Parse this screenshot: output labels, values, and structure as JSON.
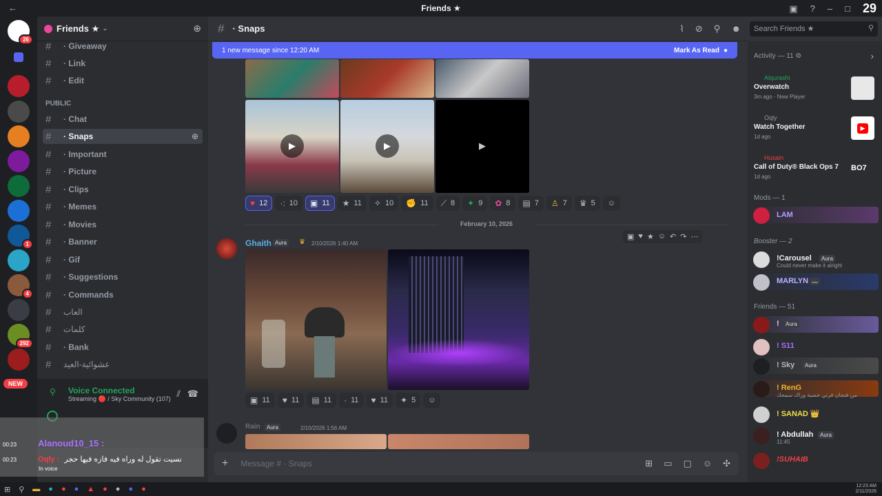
{
  "window": {
    "title": "Friends ★",
    "corner_number": "29"
  },
  "server_rail": {
    "badges": {
      "home": "26",
      "s7": "1",
      "s10": "4",
      "s12": "292"
    },
    "new_label": "NEW"
  },
  "guild": {
    "name": "Friends ★"
  },
  "channels_top": [
    {
      "label": "· Giveaway"
    },
    {
      "label": "· Link"
    },
    {
      "label": "· Edit"
    }
  ],
  "category_public": "PUBLIC",
  "channels": [
    {
      "label": "· Chat"
    },
    {
      "label": "· Snaps"
    },
    {
      "label": "· Important"
    },
    {
      "label": "· Picture"
    },
    {
      "label": "· Clips"
    },
    {
      "label": "· Memes"
    },
    {
      "label": "· Movies"
    },
    {
      "label": "· Banner"
    },
    {
      "label": "· Gif"
    },
    {
      "label": "· Suggestions"
    },
    {
      "label": "· Commands"
    },
    {
      "label": "العاب"
    },
    {
      "label": "كلمات"
    },
    {
      "label": "· Bank"
    },
    {
      "label": "عشوائية-العيد"
    }
  ],
  "voice": {
    "title": "Voice Connected",
    "subtitle": "Streaming 🔴 / Sky Community (107)"
  },
  "overlay": {
    "line1_time": "00:23",
    "line1_user": "Alanoud10_15 :",
    "line2_time": "00:23",
    "line2_user": "Oqly :",
    "line2_text": "نسيت تقول له وراه فيه فازه فيها حجر",
    "line3": "In voice"
  },
  "chat_header": {
    "channel": "· Snaps"
  },
  "search": {
    "placeholder": "Search Friends ★"
  },
  "new_messages": {
    "text": "1 new message since 12:20 AM",
    "action": "Mark As Read"
  },
  "reactions_1": [
    {
      "emoji": "♥",
      "count": "12",
      "me": true
    },
    {
      "emoji": "·:",
      "count": "10",
      "me": false
    },
    {
      "emoji": "▣",
      "count": "11",
      "me": true
    },
    {
      "emoji": "★",
      "count": "11",
      "me": false
    },
    {
      "emoji": "✧",
      "count": "10",
      "me": false
    },
    {
      "emoji": "✊",
      "count": "11",
      "me": false
    },
    {
      "emoji": "⟋",
      "count": "8",
      "me": false
    },
    {
      "emoji": "✦",
      "count": "9",
      "me": false
    },
    {
      "emoji": "✿",
      "count": "8",
      "me": false
    },
    {
      "emoji": "▤",
      "count": "7",
      "me": false
    },
    {
      "emoji": "♙",
      "count": "7",
      "me": false
    },
    {
      "emoji": "♛",
      "count": "5",
      "me": false
    }
  ],
  "date_divider": "February 10, 2026",
  "message": {
    "author": "Ghaith",
    "tag": "Aura",
    "timestamp": "2/10/2026 1:40 AM"
  },
  "reactions_2": [
    {
      "emoji": "▣",
      "count": "11"
    },
    {
      "emoji": "♥",
      "count": "11"
    },
    {
      "emoji": "▤",
      "count": "11"
    },
    {
      "emoji": "·",
      "count": "11"
    },
    {
      "emoji": "♥",
      "count": "11"
    },
    {
      "emoji": "✦",
      "count": "5"
    }
  ],
  "next_message": {
    "author": "Rain",
    "tag": "Aura",
    "timestamp": "2/10/2026 1:56 AM"
  },
  "composer": {
    "placeholder": "Message # · Snaps"
  },
  "activity": {
    "header": "Activity — 11",
    "items": [
      {
        "user": "Alqurashi",
        "game": "Overwatch",
        "meta": "3m ago · New Player"
      },
      {
        "user": "Oqly",
        "game": "Watch Together",
        "meta": "1d ago"
      },
      {
        "user": "Husain",
        "game": "Call of Duty® Black Ops 7",
        "meta": "1d ago"
      }
    ]
  },
  "mods_header": "Mods — 1",
  "mods": [
    {
      "name": "LAM"
    }
  ],
  "booster_header": "Booster — 2",
  "boosters": [
    {
      "name": "!Carousel",
      "tag": "Aura",
      "status": "Could never make it alright"
    },
    {
      "name": "MARLYN",
      "tag": "ᴗᴗ",
      "status": ""
    }
  ],
  "friends_header": "Friends — 51",
  "friends": [
    {
      "name": "!",
      "tag": "Aura",
      "status": "",
      "color": "#f2f3f5"
    },
    {
      "name": "! S11",
      "tag": "",
      "status": "",
      "color": "#a970ff"
    },
    {
      "name": "! Sky",
      "tag": "Aura",
      "status": "",
      "color": "#dbdee1"
    },
    {
      "name": "! RenG",
      "tag": "",
      "status": "من فنجان قرني خسية وراك سمحك",
      "color": "#f0b232"
    },
    {
      "name": "! SANAD 👑",
      "tag": "",
      "status": "",
      "color": "#f0e04a"
    },
    {
      "name": "! Abdullah",
      "tag": "Aura",
      "status": "11:45",
      "color": "#f2f3f5"
    },
    {
      "name": "!SUHAIB",
      "tag": "",
      "status": "",
      "color": "#f23f43"
    }
  ],
  "taskbar": {
    "time": "12:23 AM",
    "date": "2/11/2026"
  },
  "colors": {
    "blurple": "#5865f2",
    "online": "#23a55a",
    "danger": "#f23f43"
  }
}
